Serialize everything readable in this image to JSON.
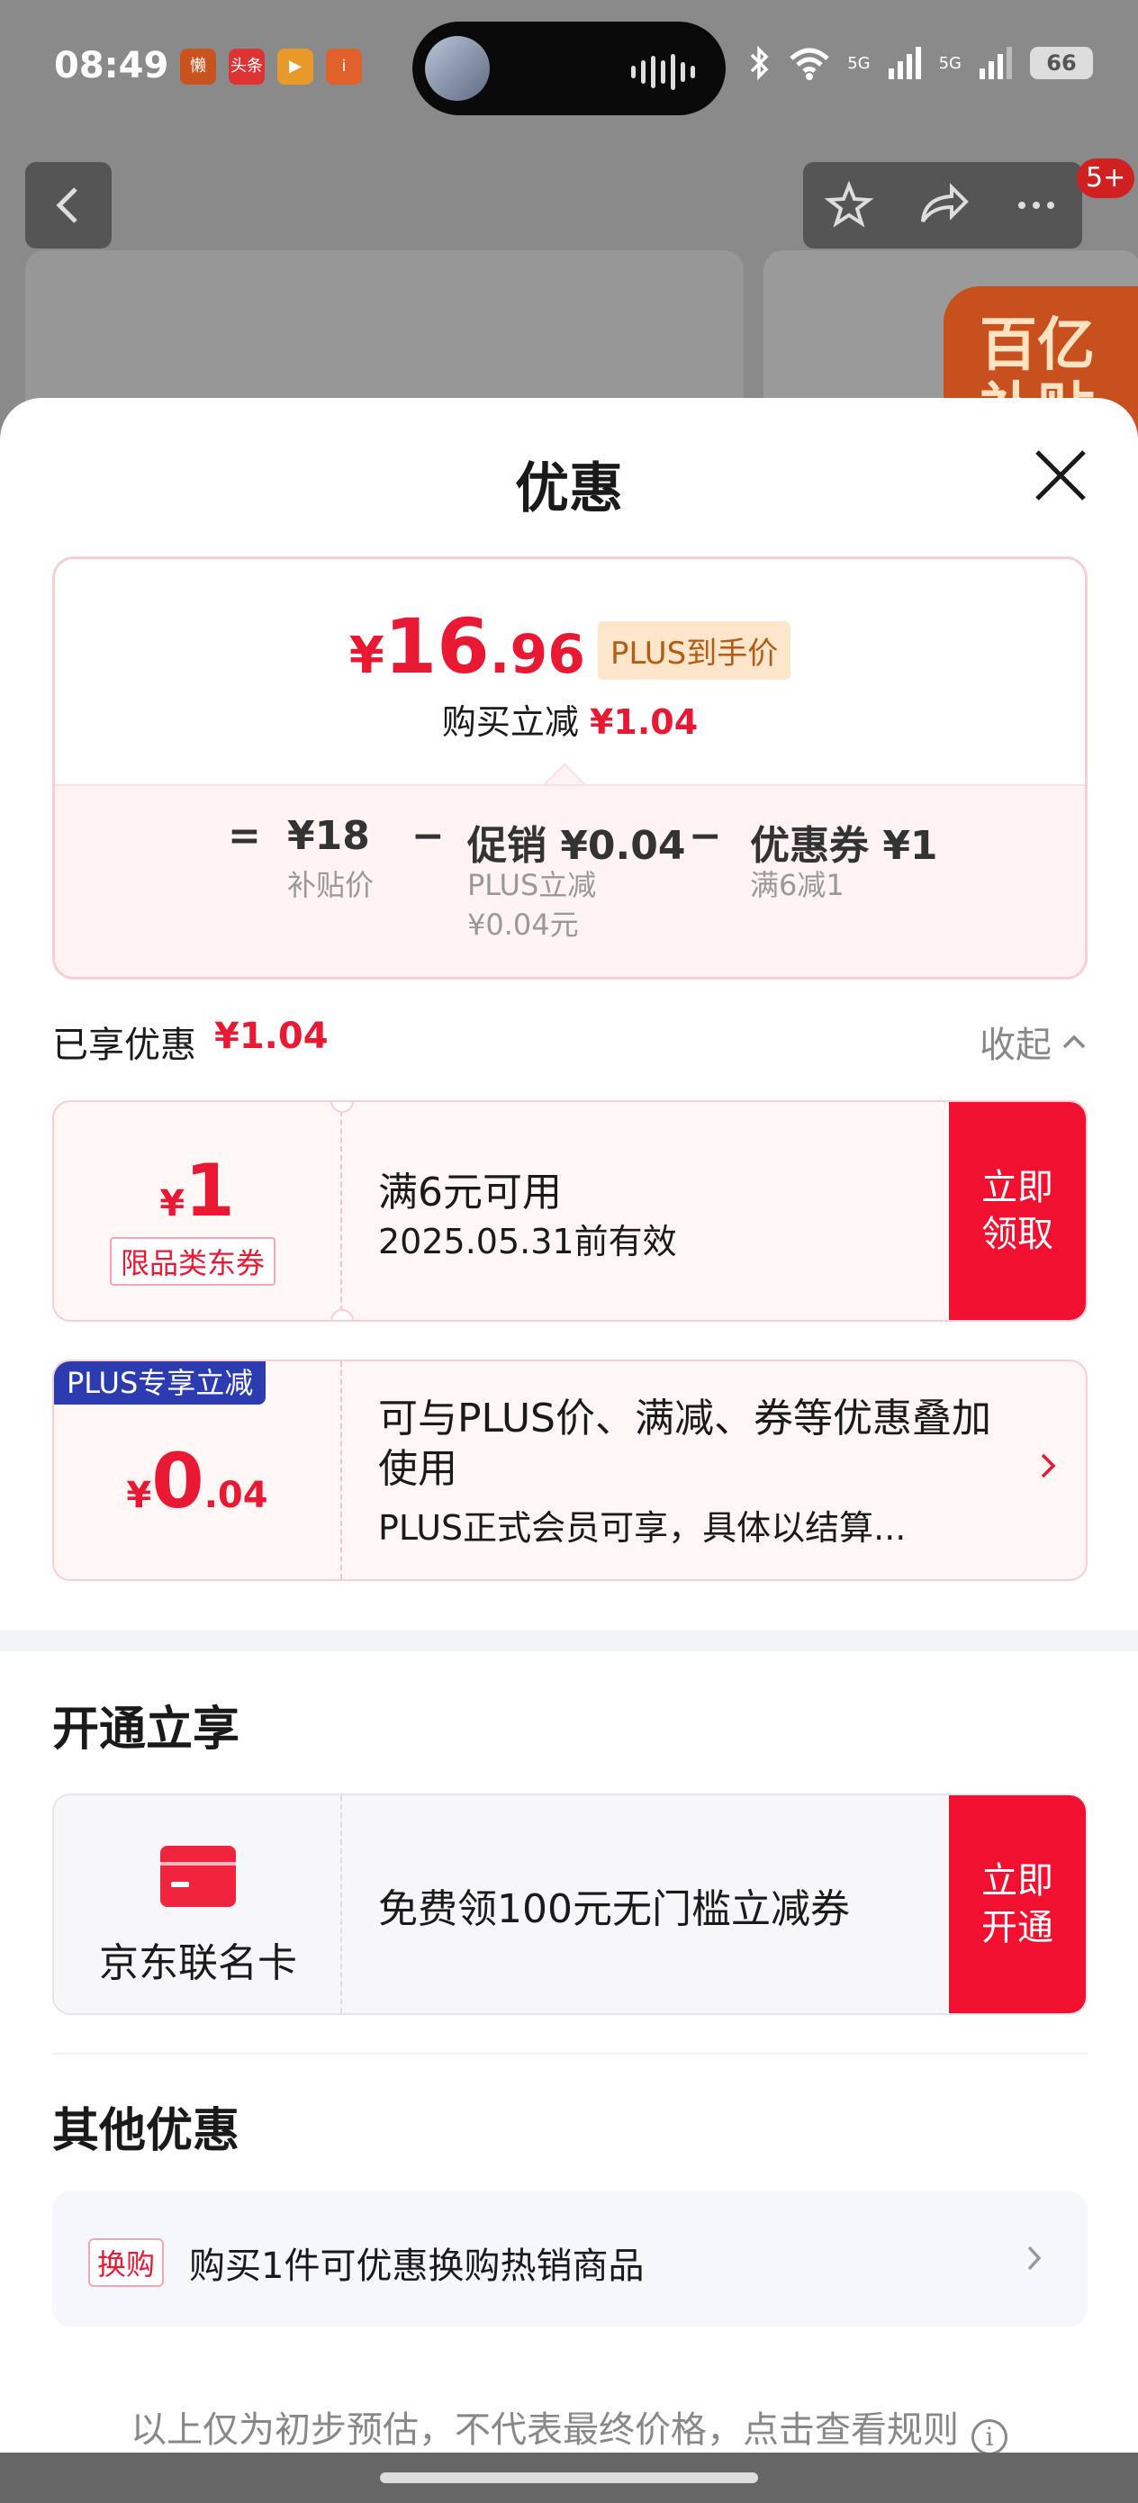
{
  "status_bar": {
    "time": "08:49",
    "apps": [
      "懒",
      "头条",
      "▶",
      "i"
    ],
    "network_labels": [
      "5G",
      "5G"
    ],
    "battery": "66"
  },
  "background": {
    "badge": "5+",
    "promo_text": "百亿补贴"
  },
  "sheet": {
    "title": "优惠",
    "summary": {
      "currency": "¥",
      "price_int": "16",
      "price_dec": ".96",
      "tag": "PLUS到手价",
      "discount_label": "购买立减",
      "discount_value": "¥1.04"
    },
    "formula": {
      "equals": "=",
      "minus": "−",
      "base_price": "¥18",
      "base_label": "补贴价",
      "promo_title": "促销 ¥0.04",
      "promo_sub_1": "PLUS立减",
      "promo_sub_2": "¥0.04元",
      "coupon_title": "优惠券 ¥1",
      "coupon_sub": "满6减1"
    },
    "saved": {
      "label": "已享优惠",
      "value": "¥1.04",
      "collapse_label": "收起"
    },
    "coupon_1": {
      "currency": "¥",
      "amount": "1",
      "tag": "限品类东券",
      "condition": "满6元可用",
      "validity": "2025.05.31前有效",
      "button": "立即领取"
    },
    "coupon_2": {
      "badge": "PLUS专享立减",
      "currency": "¥",
      "amount_int": "0",
      "amount_dec": ".04",
      "desc": "可与PLUS价、满减、券等优惠叠加使用",
      "note": "PLUS正式会员可享，具体以结算..."
    },
    "open_section": {
      "title": "开通立享",
      "card_name": "京东联名卡",
      "desc": "免费领100元无门槛立减券",
      "button": "立即开通"
    },
    "other_section": {
      "title": "其他优惠",
      "tag": "换购",
      "text": "购买1件可优惠换购热销商品"
    },
    "footer": "以上仅为初步预估，不代表最终价格，点击查看规则"
  },
  "colors": {
    "accent_red": "#e91934",
    "button_red": "#f1102f",
    "plus_blue": "#2c3cb0",
    "tag_orange_bg": "#fde6cb"
  }
}
